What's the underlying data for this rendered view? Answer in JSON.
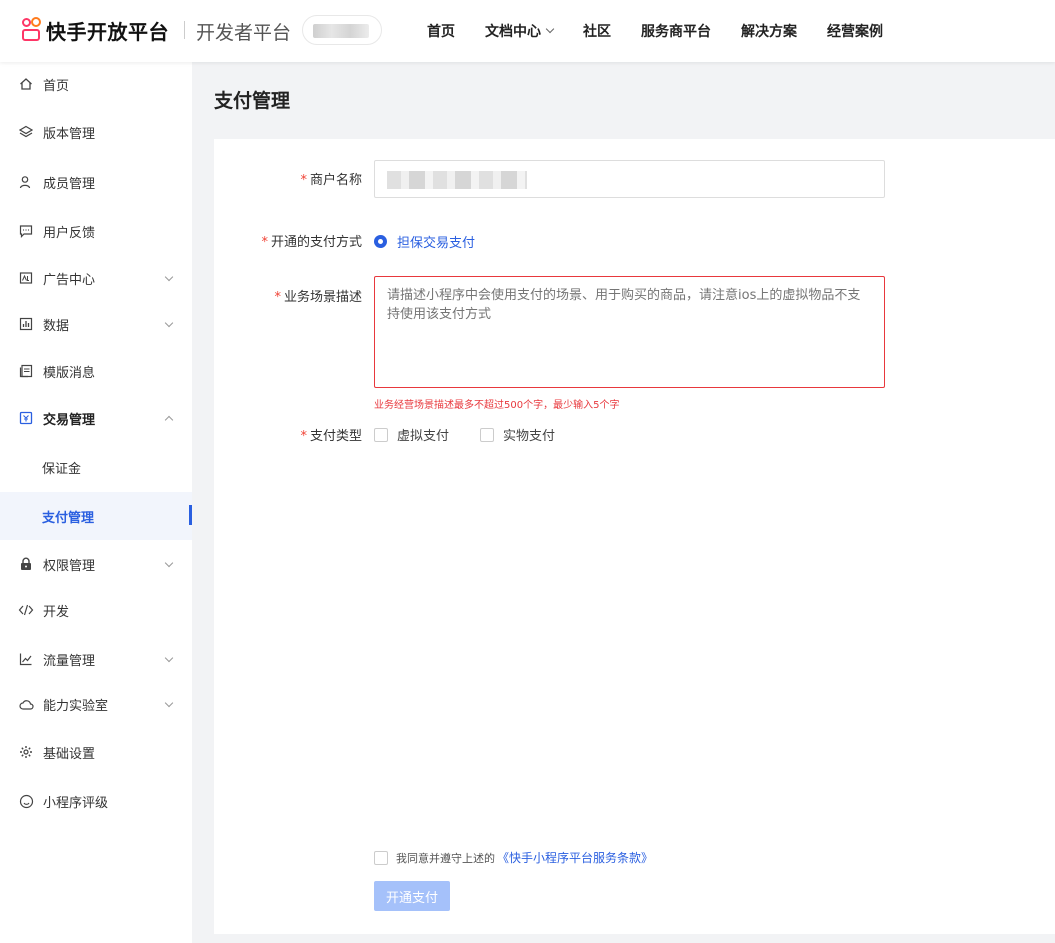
{
  "header": {
    "logo_text": "快手开放平台",
    "dev_title": "开发者平台",
    "nav": [
      {
        "label": "首页"
      },
      {
        "label": "文档中心"
      },
      {
        "label": "社区"
      },
      {
        "label": "服务商平台"
      },
      {
        "label": "解决方案"
      },
      {
        "label": "经营案例"
      }
    ]
  },
  "sidebar": {
    "items": [
      {
        "label": "首页",
        "icon": "home-icon"
      },
      {
        "label": "版本管理",
        "icon": "layers-icon"
      },
      {
        "label": "成员管理",
        "icon": "user-icon"
      },
      {
        "label": "用户反馈",
        "icon": "message-icon"
      },
      {
        "label": "广告中心",
        "icon": "ad-icon"
      },
      {
        "label": "数据",
        "icon": "chart-icon"
      },
      {
        "label": "模版消息",
        "icon": "template-icon"
      },
      {
        "label": "交易管理",
        "icon": "trade-icon"
      },
      {
        "label": "保证金"
      },
      {
        "label": "支付管理"
      },
      {
        "label": "权限管理",
        "icon": "lock-icon"
      },
      {
        "label": "开发",
        "icon": "code-icon"
      },
      {
        "label": "流量管理",
        "icon": "trend-icon"
      },
      {
        "label": "能力实验室",
        "icon": "cloud-icon"
      },
      {
        "label": "基础设置",
        "icon": "gear-icon"
      },
      {
        "label": "小程序评级",
        "icon": "rating-icon"
      }
    ]
  },
  "page": {
    "title": "支付管理"
  },
  "form": {
    "merchant_label": "商户名称",
    "pay_method_label": "开通的支付方式",
    "pay_method_option": "担保交易支付",
    "scene_label": "业务场景描述",
    "scene_placeholder": "请描述小程序中会使用支付的场景、用于购买的商品，请注意ios上的虚拟物品不支持使用该支付方式",
    "scene_error": "业务经营场景描述最多不超过500个字，最少输入5个字",
    "pay_type_label": "支付类型",
    "pay_type_virtual": "虚拟支付",
    "pay_type_physical": "实物支付",
    "agree_text": "我同意并遵守上述的",
    "agree_link": "《快手小程序平台服务条款》",
    "submit_label": "开通支付"
  },
  "colors": {
    "accent": "#2a5fe0",
    "error": "#e8383d",
    "required": "#f04134",
    "submit_disabled": "#a5c1fa"
  }
}
